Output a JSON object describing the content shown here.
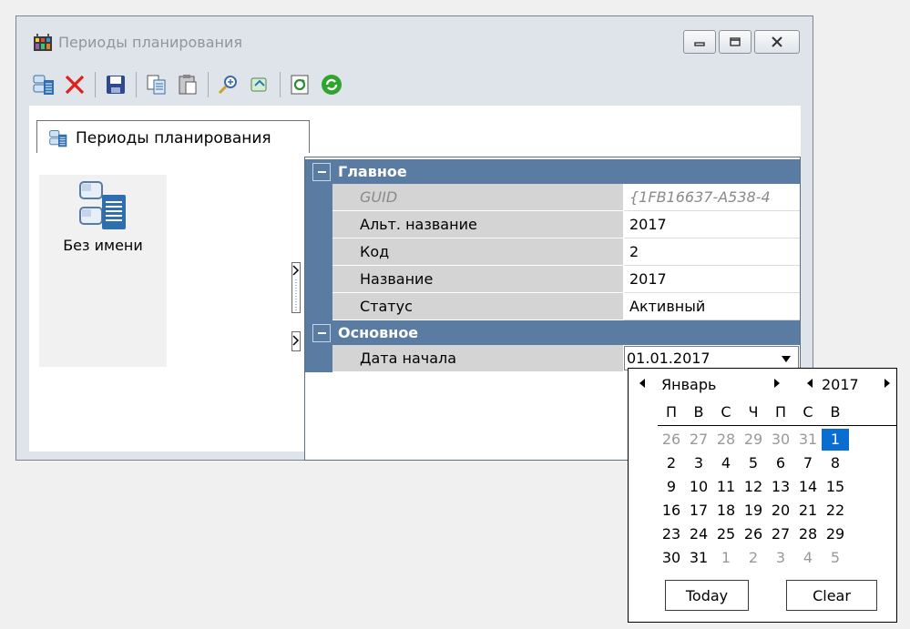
{
  "window": {
    "title": "Периоды планирования"
  },
  "toolbar": {
    "icons": [
      "new-record-icon",
      "delete-icon",
      "save-icon",
      "copy-icon",
      "paste-icon",
      "find-icon",
      "filter-icon",
      "refresh-icon",
      "reload-icon"
    ]
  },
  "tab": {
    "label": "Периоды планирования"
  },
  "left_panel": {
    "item_label": "Без имени"
  },
  "grid": {
    "categories": [
      {
        "label": "Главное",
        "rows": [
          {
            "name": "GUID",
            "value": "{1FB16637-A538-4"
          },
          {
            "name": "Альт. название",
            "value": "2017"
          },
          {
            "name": "Код",
            "value": "2"
          },
          {
            "name": "Название",
            "value": "2017"
          },
          {
            "name": "Статус",
            "value": "Активный"
          }
        ]
      },
      {
        "label": "Основное",
        "rows": [
          {
            "name": "Дата начала",
            "value": "01.01.2017"
          }
        ]
      }
    ]
  },
  "calendar": {
    "month": "Январь",
    "year": "2017",
    "weekdays": [
      "П",
      "В",
      "С",
      "Ч",
      "П",
      "С",
      "В"
    ],
    "weeks": [
      [
        "26",
        "27",
        "28",
        "29",
        "30",
        "31",
        "1"
      ],
      [
        "2",
        "3",
        "4",
        "5",
        "6",
        "7",
        "8"
      ],
      [
        "9",
        "10",
        "11",
        "12",
        "13",
        "14",
        "15"
      ],
      [
        "16",
        "17",
        "18",
        "19",
        "20",
        "21",
        "22"
      ],
      [
        "23",
        "24",
        "25",
        "26",
        "27",
        "28",
        "29"
      ],
      [
        "30",
        "31",
        "1",
        "2",
        "3",
        "4",
        "5"
      ]
    ],
    "selected": "1",
    "today_label": "Today",
    "clear_label": "Clear"
  },
  "colors": {
    "category_bar": "#5a7ca2",
    "selected_day": "#0a6ed0"
  }
}
